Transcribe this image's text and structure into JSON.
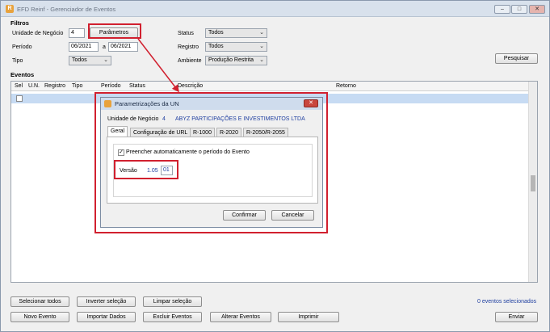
{
  "window": {
    "title": "EFD Reinf - Gerenciador de Eventos",
    "buttons": [
      "–",
      "□",
      "✕"
    ]
  },
  "filters": {
    "section_title": "Filtros",
    "unidade_label": "Unidade de Negócio",
    "unidade_value": "4",
    "parametros_button": "Parâmetros",
    "periodo_label": "Período",
    "periodo_from": "06/2021",
    "periodo_sep": "a",
    "periodo_to": "06/2021",
    "tipo_label": "Tipo",
    "tipo_value": "Todos",
    "status_label": "Status",
    "status_value": "Todos",
    "registro_label": "Registro",
    "registro_value": "Todos",
    "ambiente_label": "Ambiente",
    "ambiente_value": "Produção Restrita",
    "pesquisar_button": "Pesquisar"
  },
  "events": {
    "section_title": "Eventos",
    "columns": [
      "Sel",
      "U.N.",
      "Registro",
      "Tipo",
      "Período",
      "Status",
      "Descrição",
      "Retorno"
    ]
  },
  "dialog": {
    "title": "Parametrizações da UN",
    "close": "✕",
    "unidade_label": "Unidade de Negócio",
    "unidade_value": "4",
    "unidade_name": "ABYZ PARTICIPAÇÕES E INVESTIMENTOS LTDA",
    "tabs": [
      "Geral",
      "Configuração de URL",
      "R-1000",
      "R-2020",
      "R-2050/R-2055"
    ],
    "checkbox_label": "Preencher automaticamente o período do Evento",
    "versao_label": "Versão",
    "versao_value": "1.05",
    "versao_input": "01",
    "confirmar_button": "Confirmar",
    "cancelar_button": "Cancelar"
  },
  "footer": {
    "selecionar_todos": "Selecionar todos",
    "inverter_selecao": "Inverter seleção",
    "limpar_selecao": "Limpar seleção",
    "selected_count": "0 eventos selecionados",
    "novo_evento": "Novo Evento",
    "importar_dados": "Importar Dados",
    "excluir_eventos": "Excluir Eventos",
    "alterar_eventos": "Alterar Eventos",
    "imprimir": "Imprimir",
    "enviar": "Enviar"
  },
  "colors": {
    "highlight": "#d1202f",
    "selected_row": "#c7dbf3",
    "link_text": "#1f3fa0"
  }
}
